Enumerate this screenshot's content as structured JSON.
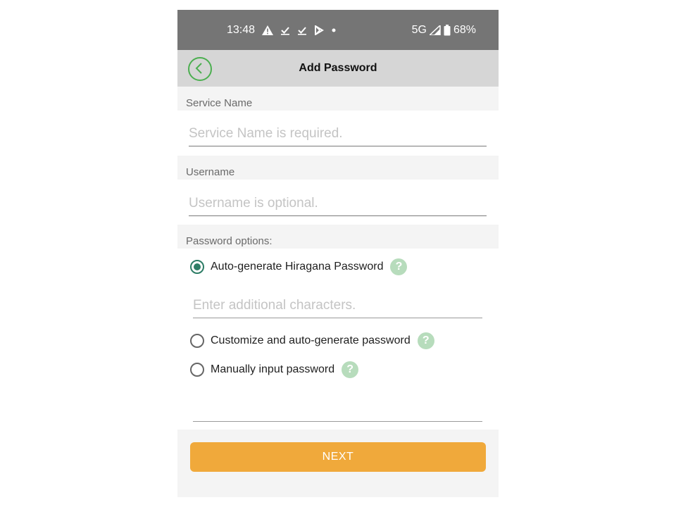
{
  "status_bar": {
    "time": "13:48",
    "left_icons": [
      "alert-icon",
      "check-icon",
      "check-icon",
      "play-store-icon",
      "dot-icon"
    ],
    "network": "5G",
    "battery": "68%"
  },
  "app_bar": {
    "title": "Add Password",
    "back_icon": "chevron-left-icon",
    "accent_color": "#4caf50"
  },
  "service": {
    "label": "Service Name",
    "placeholder": "Service Name is required.",
    "value": ""
  },
  "username": {
    "label": "Username",
    "placeholder": "Username is optional.",
    "value": ""
  },
  "password_options": {
    "label": "Password options:",
    "options": [
      {
        "label": "Auto-generate Hiragana Password",
        "selected": true
      },
      {
        "label": "Customize and auto-generate password",
        "selected": false
      },
      {
        "label": "Manually input password",
        "selected": false
      }
    ],
    "help_symbol": "?",
    "additional_placeholder": "Enter additional characters.",
    "manual_placeholder": ""
  },
  "next_button": {
    "label": "NEXT",
    "color": "#f0a93b"
  }
}
